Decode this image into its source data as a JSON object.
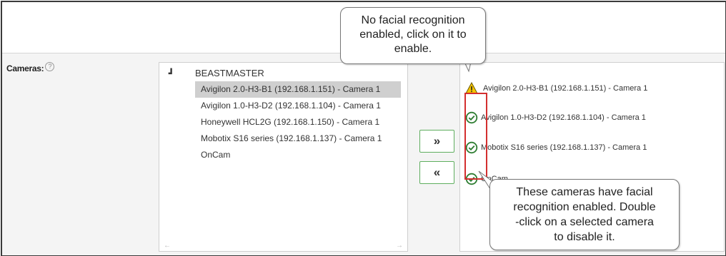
{
  "cameras_label": "Cameras:",
  "help_glyph": "?",
  "available": {
    "toggle": "┛",
    "root": "BEASTMASTER",
    "items": [
      "Avigilon 2.0-H3-B1 (192.168.1.151) - Camera 1",
      "Avigilon 1.0-H3-D2 (192.168.1.104) - Camera 1",
      "Honeywell HCL2G (192.168.1.150) - Camera 1",
      "Mobotix S16 series (192.168.1.137) - Camera 1",
      "OnCam"
    ],
    "scroll_left": "←",
    "scroll_right": "→"
  },
  "buttons": {
    "add": "»",
    "remove": "«"
  },
  "selected": [
    {
      "icon": "warning-icon",
      "label": "Avigilon 2.0-H3-B1 (192.168.1.151) - Camera 1"
    },
    {
      "icon": "check-circle-icon",
      "label": "Avigilon 1.0-H3-D2 (192.168.1.104) - Camera 1"
    },
    {
      "icon": "check-circle-icon",
      "label": "Mobotix S16 series (192.168.1.137) - Camera 1"
    },
    {
      "icon": "check-circle-icon",
      "label": "OnCam"
    }
  ],
  "callouts": {
    "top": [
      "No facial recognition",
      "enabled, click on it to",
      "enable."
    ],
    "bottom": [
      "These cameras have facial",
      "recognition enabled. Double",
      "-click on a selected camera",
      "to disable it."
    ]
  },
  "colors": {
    "check": "#2e7d32",
    "warning": "#f5c400",
    "highlight_box": "#d32f2f",
    "button_border": "#5fae5f"
  }
}
